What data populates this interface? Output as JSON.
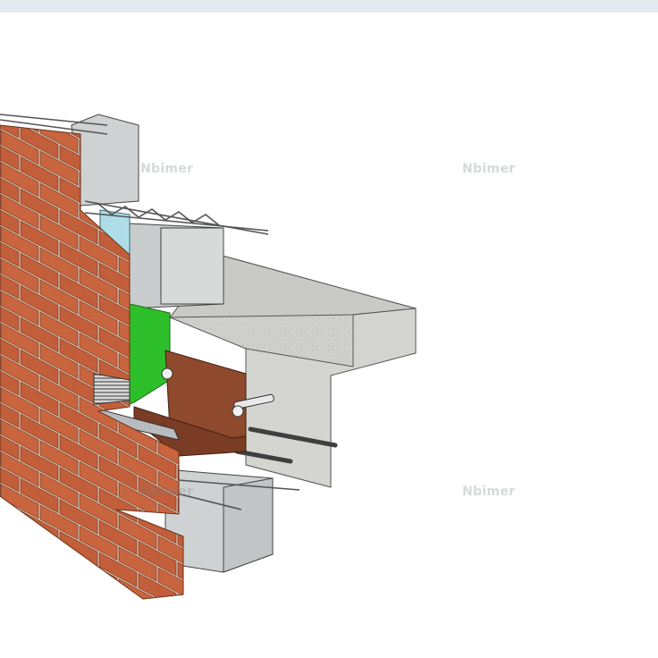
{
  "watermark": {
    "text": "Nbimer",
    "color": "#7f8a8f"
  },
  "colors": {
    "brick": "#c8653f",
    "brick_mortar": "#e9d7c6",
    "concrete": "#cfcfcb",
    "cmu_block": "#cfd2d2",
    "insulation": "#aedde8",
    "flashing": "#2dbf2a",
    "steel_angle": "#8f4a2e",
    "rebar": "#555555",
    "background": "#ffffff"
  },
  "components": [
    "brick-veneer",
    "cmu-backup-wall",
    "rigid-insulation",
    "joint-reinforcement",
    "through-wall-flashing",
    "steel-shelf-angle",
    "anchor-bolt",
    "concrete-slab-edge",
    "slab-rebar",
    "weep-vent",
    "drip-edge"
  ]
}
